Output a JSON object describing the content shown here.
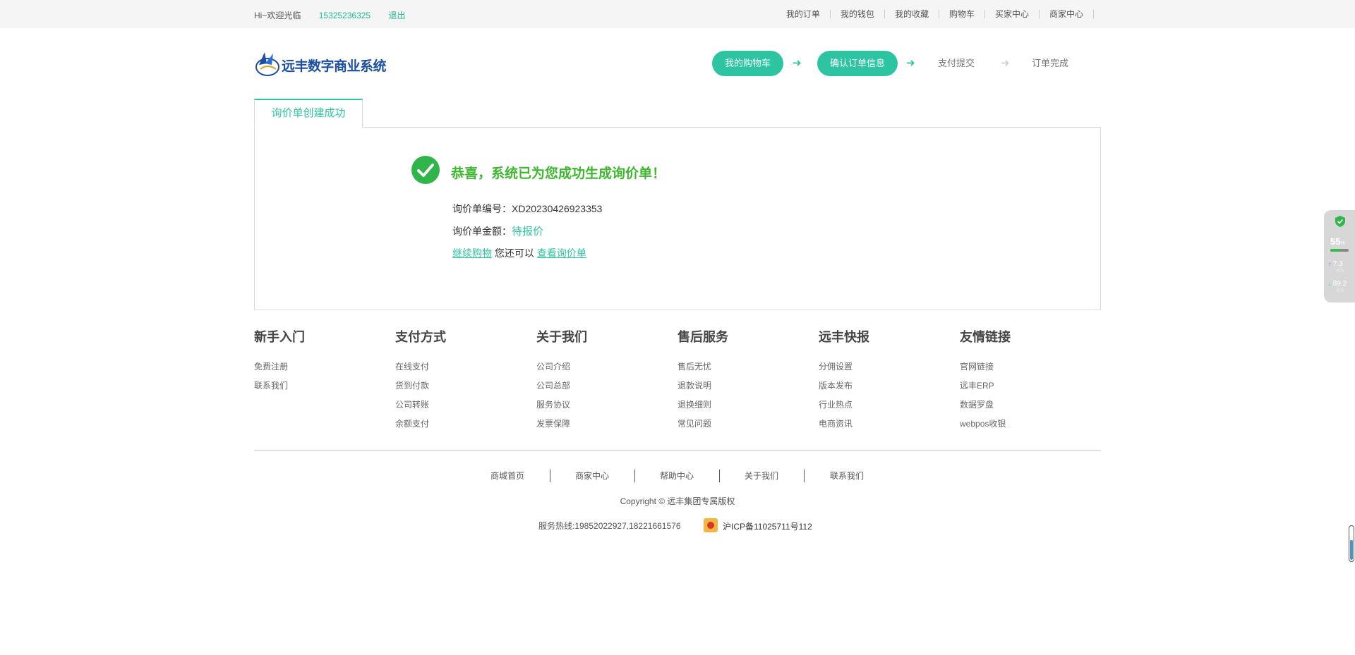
{
  "topbar": {
    "welcome": "Hi~欢迎光临",
    "phone": "15325236325",
    "logout": "退出",
    "links": [
      "我的订单",
      "我的钱包",
      "我的收藏",
      "购物车",
      "买家中心",
      "商家中心"
    ]
  },
  "header": {
    "logo_text": "远丰数字商业系统",
    "steps": [
      {
        "label": "我的购物车",
        "state": "done"
      },
      {
        "label": "确认订单信息",
        "state": "done"
      },
      {
        "label": "支付提交",
        "state": "pending"
      },
      {
        "label": "订单完成",
        "state": "pending"
      }
    ],
    "arrow_glyph": "➜"
  },
  "tab": {
    "label": "询价单创建成功"
  },
  "result": {
    "title": "恭喜，系统已为您成功生成询价单！",
    "order_no_label": "询价单编号：",
    "order_no": "XD20230426923353",
    "amount_label": "询价单金额：",
    "amount": "待报价",
    "continue_link": "继续购物",
    "middle_text": "您还可以",
    "view_link": "查看询价单"
  },
  "footer": {
    "columns": [
      {
        "title": "新手入门",
        "links": [
          "免费注册",
          "联系我们"
        ]
      },
      {
        "title": "支付方式",
        "links": [
          "在线支付",
          "货到付款",
          "公司转账",
          "余额支付"
        ]
      },
      {
        "title": "关于我们",
        "links": [
          "公司介绍",
          "公司总部",
          "服务协议",
          "发票保障"
        ]
      },
      {
        "title": "售后服务",
        "links": [
          "售后无忧",
          "退款说明",
          "退换细则",
          "常见问题"
        ]
      },
      {
        "title": "远丰快报",
        "links": [
          "分佣设置",
          "版本发布",
          "行业热点",
          "电商资讯"
        ]
      },
      {
        "title": "友情链接",
        "links": [
          "官网链接",
          "远丰ERP",
          "数据罗盘",
          "webpos收银"
        ]
      }
    ],
    "bottom_links": [
      "商城首页",
      "商家中心",
      "帮助中心",
      "关于我们",
      "联系我们"
    ],
    "copyright": "Copyright © 远丰集团专属版权",
    "hotline": "服务热线:19852022927,18221661576",
    "icp": "沪ICP备11025711号112"
  },
  "widget": {
    "percent": "55",
    "percent_unit": "%",
    "upload": "7.3",
    "download": "89.2",
    "speed_unit": "K/s"
  },
  "colors": {
    "accent": "#2dc5a1",
    "success": "#3db82e",
    "logo_blue": "#1c4fa3"
  }
}
